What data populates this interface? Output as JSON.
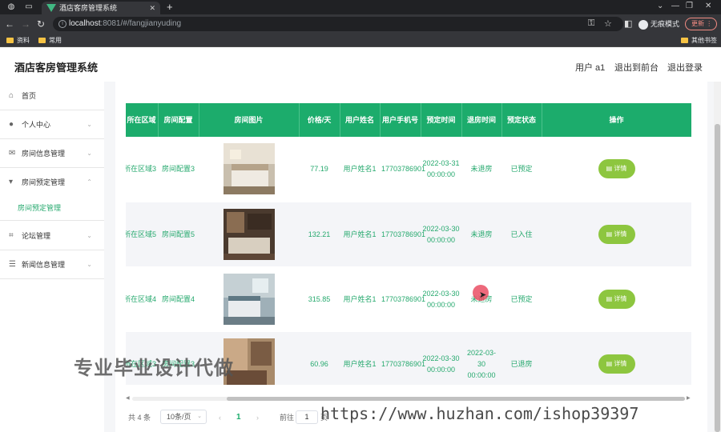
{
  "browser": {
    "tab_title": "酒店客房管理系统",
    "new_tab": "+",
    "url_host": "localhost",
    "url_rest": ":8081/#/fangjianyuding",
    "incognito_label": "无痕模式",
    "update_label": "更新",
    "bookmarks": [
      "资料",
      "常用"
    ],
    "other_bookmarks": "其他书签"
  },
  "header": {
    "title": "酒店客房管理系统",
    "user": "用户 a1",
    "to_front": "退出到前台",
    "logout": "退出登录"
  },
  "sidebar": {
    "items": [
      {
        "label": "首页",
        "icon": "home-icon"
      },
      {
        "label": "个人中心",
        "icon": "user-icon"
      },
      {
        "label": "房间信息管理",
        "icon": "mail-icon"
      },
      {
        "label": "房间预定管理",
        "icon": "pin-icon"
      },
      {
        "label": "论坛管理",
        "icon": "frame-icon"
      },
      {
        "label": "新闻信息管理",
        "icon": "sliders-icon"
      }
    ],
    "sub_item": "房间预定管理"
  },
  "table": {
    "columns": [
      "所在区域",
      "房间配置",
      "房间图片",
      "价格/天",
      "用户姓名",
      "用户手机号",
      "预定时间",
      "退房时间",
      "预定状态",
      "操作"
    ],
    "rows": [
      {
        "area": "所在区域3",
        "config": "房间配置3",
        "price": "77.19",
        "name": "用户姓名1",
        "phone": "17703786901",
        "book_time": "2022-03-31 00:00:00",
        "checkout": "未退房",
        "status": "已预定",
        "action": "详情"
      },
      {
        "area": "所在区域5",
        "config": "房间配置5",
        "price": "132.21",
        "name": "用户姓名1",
        "phone": "17703786901",
        "book_time": "2022-03-30 00:00:00",
        "checkout": "未退房",
        "status": "已入住",
        "action": "详情"
      },
      {
        "area": "所在区域4",
        "config": "房间配置4",
        "price": "315.85",
        "name": "用户姓名1",
        "phone": "17703786901",
        "book_time": "2022-03-30 00:00:00",
        "checkout": "未退房",
        "status": "已预定",
        "action": "详情"
      },
      {
        "area": "所在区域3",
        "config": "房间配置3",
        "price": "60.96",
        "name": "用户姓名1",
        "phone": "17703786901",
        "book_time": "2022-03-30 00:00:00",
        "checkout": "2022-03-30 00:00:00",
        "status": "已退房",
        "action": "详情"
      }
    ]
  },
  "pagination": {
    "total": "共 4 条",
    "page_size": "10条/页",
    "prev": "‹",
    "current": "1",
    "next": "›",
    "goto_label": "前往",
    "goto_value": "1",
    "page_unit": "页"
  },
  "overlay": {
    "watermark_cn": "专业毕业设计代做",
    "watermark_url": "https://www.huzhan.com/ishop39397"
  },
  "colors": {
    "accent": "#1cac6c",
    "button": "#8dc63f"
  }
}
